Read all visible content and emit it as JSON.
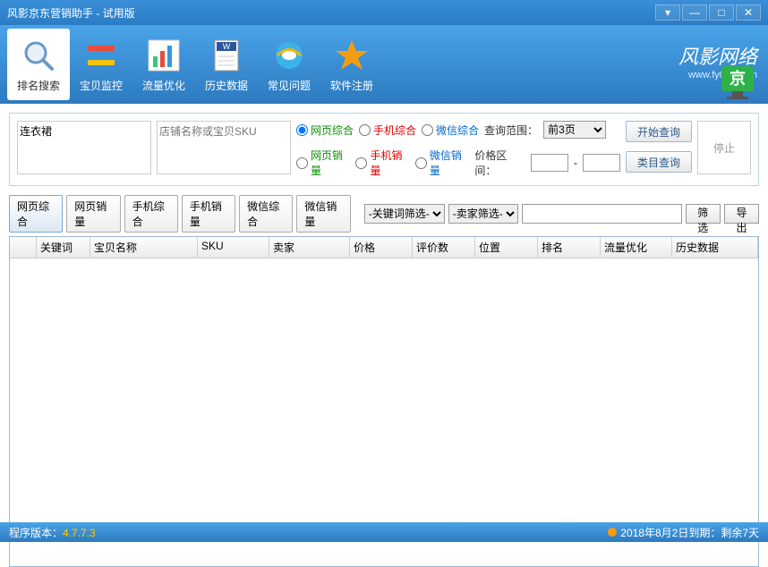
{
  "title": "风影京东营销助手 - 试用版",
  "brand": {
    "text": "风影网络",
    "url": "www.fy027.com"
  },
  "toolbar": [
    {
      "label": "排名搜索",
      "name": "rank-search"
    },
    {
      "label": "宝贝监控",
      "name": "item-monitor"
    },
    {
      "label": "流量优化",
      "name": "traffic-opt"
    },
    {
      "label": "历史数据",
      "name": "history-data"
    },
    {
      "label": "常见问题",
      "name": "faq"
    },
    {
      "label": "软件注册",
      "name": "register"
    }
  ],
  "search": {
    "keyword": "连衣裙",
    "shop_placeholder": "店铺名称或宝贝SKU",
    "radios1": {
      "web": "网页综合",
      "mobile": "手机综合",
      "wechat": "微信综合"
    },
    "radios2": {
      "web": "网页销量",
      "mobile": "手机销量",
      "wechat": "微信销量"
    },
    "range_label": "查询范围：",
    "range_value": "前3页",
    "start_btn": "开始查询",
    "price_label": "价格区间：",
    "dash": "-",
    "category_btn": "类目查询",
    "stop_btn": "停止"
  },
  "tabs": [
    "网页综合",
    "网页销量",
    "手机综合",
    "手机销量",
    "微信综合",
    "微信销量"
  ],
  "filters": {
    "kw": "-关键词筛选-",
    "seller": "-卖家筛选-",
    "filter_btn": "筛选",
    "export_btn": "导出"
  },
  "columns": [
    "",
    "关键词",
    "宝贝名称",
    "SKU",
    "卖家",
    "价格",
    "评价数",
    "位置",
    "排名",
    "流量优化",
    "历史数据"
  ],
  "status": {
    "version_label": "程序版本：",
    "version": "4.7.7.3",
    "expiry": "2018年8月2日到期：剩余7天"
  }
}
